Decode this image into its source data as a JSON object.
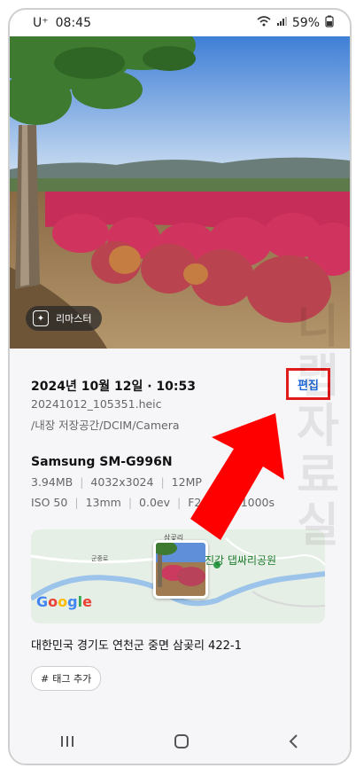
{
  "status": {
    "carrier": "U⁺",
    "time": "08:45",
    "battery": "59%"
  },
  "photo": {
    "remaster_label": "리마스터"
  },
  "details": {
    "datetime": "2024년 10월 12일 · 10:53",
    "edit_label": "편집",
    "filename": "20241012_105351.heic",
    "path": "/내장 저장공간/DCIM/Camera",
    "device": "Samsung SM-G996N",
    "specs_row1": [
      "3.94MB",
      "4032x3024",
      "12MP"
    ],
    "specs_row2": [
      "ISO 50",
      "13mm",
      "0.0ev",
      "F2.2",
      "1/1000s"
    ]
  },
  "map": {
    "place": "진강 댑싸리공원",
    "town": "삼곶리",
    "town2": "군중로",
    "logo": "Google"
  },
  "address": "대한민국 경기도 연천군 중면 삼곶리 422-1",
  "tag_button": {
    "label": "태그 추가",
    "icon": "#"
  },
  "watermark": "니랩자료실",
  "nav": {
    "recent": "recent-apps-icon",
    "home": "home-icon",
    "back": "back-icon"
  },
  "colors": {
    "highlight": "#e01b1b",
    "link": "#1e66d6"
  }
}
